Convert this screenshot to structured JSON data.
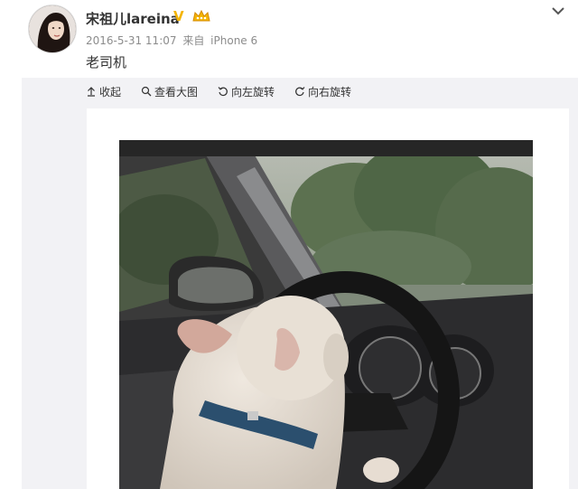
{
  "post": {
    "username": "宋祖儿lareina",
    "verified_mark": "V",
    "timestamp": "2016-5-31 11:07",
    "source_prefix": "来自",
    "device": "iPhone 6",
    "text": "老司机"
  },
  "toolbar": {
    "collapse_label": "收起",
    "view_large_label": "查看大图",
    "rotate_left_label": "向左旋转",
    "rotate_right_label": "向右旋转"
  },
  "icons": {
    "verified": "verified-v-icon",
    "vip": "vip-crown-icon",
    "more": "chevron-down-icon",
    "collapse": "arrow-up-icon",
    "view_large": "magnifier-icon",
    "rotate_left": "rotate-ccw-icon",
    "rotate_right": "rotate-cw-icon"
  },
  "colors": {
    "verified": "#f4b400",
    "meta_text": "#8c8c8c",
    "panel_bg": "#f2f2f5"
  },
  "photo": {
    "subject": "dog-driving-car-photo"
  }
}
